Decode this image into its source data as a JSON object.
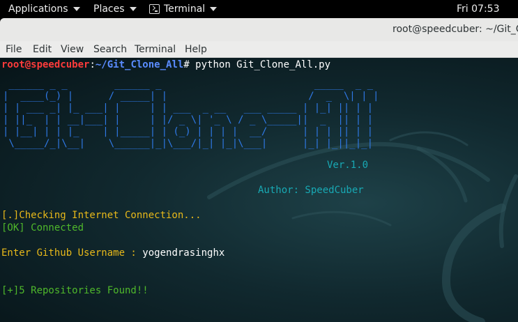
{
  "topbar": {
    "applications": "Applications",
    "places": "Places",
    "terminal": "Terminal",
    "clock": "Fri 07:53",
    "icon": "terminal-icon"
  },
  "window": {
    "title": "root@speedcuber: ~/Git_Clo"
  },
  "menubar": {
    "file": "File",
    "edit": "Edit",
    "view": "View",
    "search": "Search",
    "terminal": "Terminal",
    "help": "Help"
  },
  "terminal": {
    "prompt_user": "root@speedcuber",
    "prompt_sep": ":",
    "prompt_path": "~/Git_Clone_All",
    "prompt_symbol": "#",
    "command": " python Git_Clone_All.py",
    "ascii_art": " ______ _ _        ______ _                          _____  _ _\n|  ____(_) |      / _____| |                        /  _  \\| | |\n| | ___ _| |_ ___| |     | | ___  _ __   ___ _____ | |_| || | |\n| ||_  | | __|___| |     | |/ _ \\| '_ \\ / _ \\_____||  _  || | |\n| |__| | | |_    | |_____| | (_) | | | |  __/      | | | || | |\n \\_____/_|\\__|    \\______|_|\\___/|_| |_|\\___|      |_| |_||_|_|",
    "version": "Ver.1.0",
    "author": "Author: SpeedCuber",
    "checking": "[.]Checking Internet Connection...",
    "connected": "[OK] Connected",
    "username_prompt": "Enter Github Username : ",
    "username_value": "yogendrasinghx",
    "found": "[+]5 Repositories Found!!"
  },
  "colors": {
    "prompt_user": "#ff3b3b",
    "prompt_path": "#5a8cff",
    "ascii": "#2f79e6",
    "status_yellow": "#e8b91a",
    "status_green": "#4fb82b",
    "cyan": "#18a9b4"
  }
}
